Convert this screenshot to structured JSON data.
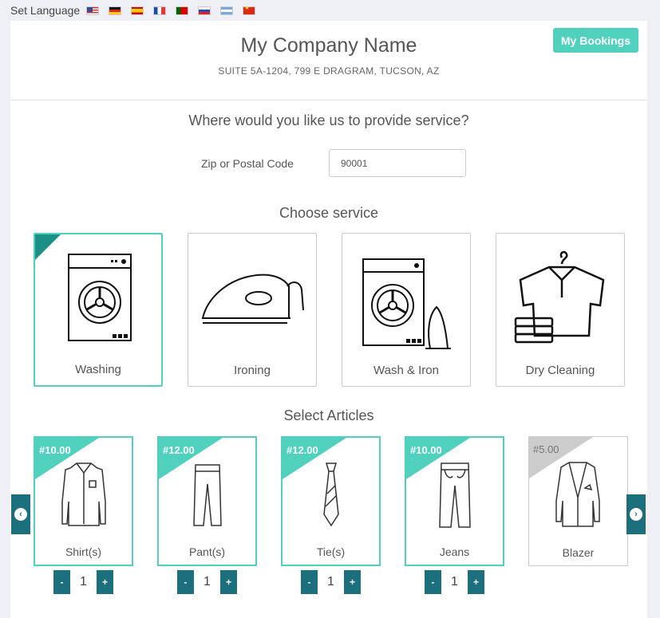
{
  "language": {
    "label": "Set Language",
    "flags": [
      "us-flag-icon",
      "de-flag-icon",
      "es-flag-icon",
      "fr-flag-icon",
      "pt-flag-icon",
      "ru-flag-icon",
      "ar-flag-icon",
      "cn-flag-icon"
    ]
  },
  "header": {
    "company_name": "My Company Name",
    "address": "SUITE 5A-1204, 799 E DRAGRAM, TUCSON, AZ",
    "bookings_label": "My Bookings"
  },
  "location": {
    "title": "Where would you like us to provide service?",
    "zip_label": "Zip or Postal Code",
    "zip_value": "90001"
  },
  "services": {
    "title": "Choose service",
    "items": [
      {
        "label": "Washing",
        "icon": "washing-machine-icon",
        "selected": true
      },
      {
        "label": "Ironing",
        "icon": "iron-icon",
        "selected": false
      },
      {
        "label": "Wash & Iron",
        "icon": "wash-and-iron-icon",
        "selected": false
      },
      {
        "label": "Dry Cleaning",
        "icon": "dry-cleaning-icon",
        "selected": false
      }
    ]
  },
  "articles": {
    "title": "Select Articles",
    "items": [
      {
        "price": "#10.00",
        "label": "Shirt(s)",
        "qty": "1",
        "icon": "shirt-icon"
      },
      {
        "price": "#12.00",
        "label": "Pant(s)",
        "qty": "1",
        "icon": "pants-icon"
      },
      {
        "price": "#12.00",
        "label": "Tie(s)",
        "qty": "1",
        "icon": "tie-icon"
      },
      {
        "price": "#10.00",
        "label": "Jeans",
        "qty": "1",
        "icon": "jeans-icon"
      },
      {
        "price": "#5.00",
        "label": "Blazer",
        "icon": "blazer-icon"
      }
    ],
    "minus_label": "-",
    "plus_label": "+"
  },
  "colors": {
    "accent": "#4fd1be",
    "dark_teal": "#1c6f7d",
    "corner_teal": "#1c8f86"
  }
}
